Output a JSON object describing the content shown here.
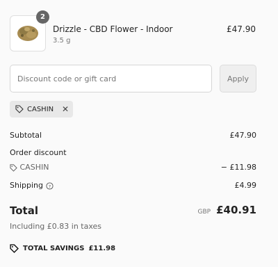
{
  "product": {
    "quantity": "2",
    "name": "Drizzle - CBD Flower - Indoor",
    "variant": "3.5 g",
    "price": "£47.90",
    "image_icon": "cannabis-bud-image"
  },
  "discount": {
    "placeholder": "Discount code or gift card",
    "value": "",
    "apply_label": "Apply",
    "applied_code": "CASHIN"
  },
  "summary": {
    "subtotal_label": "Subtotal",
    "subtotal_value": "£47.90",
    "order_discount_label": "Order discount",
    "discount_code": "CASHIN",
    "discount_value": "− £11.98",
    "shipping_label": "Shipping",
    "shipping_value": "£4.99",
    "total_label": "Total",
    "currency": "GBP",
    "total_value": "£40.91",
    "taxes_note": "Including £0.83 in taxes",
    "savings_label": "TOTAL SAVINGS",
    "savings_value": "£11.98"
  },
  "colors": {
    "background": "#fafafa",
    "badge": "#666666",
    "chip": "#e8e8e8",
    "text": "#1f1f1f"
  }
}
